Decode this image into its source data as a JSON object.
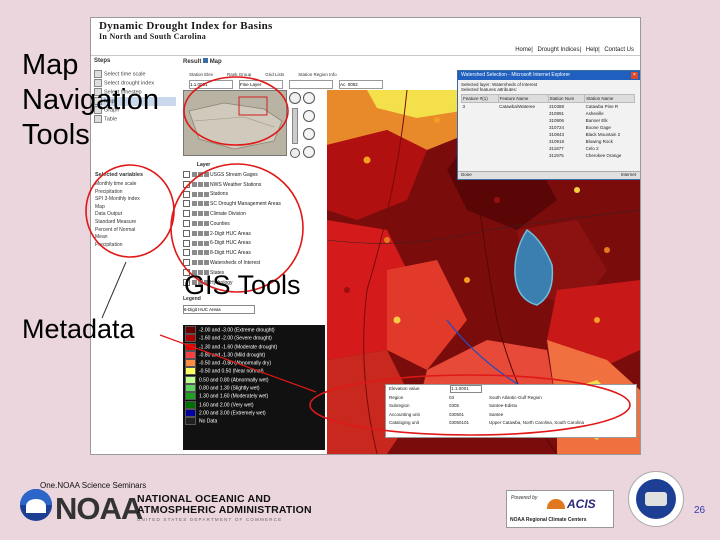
{
  "app": {
    "title": "Dynamic Drought Index for Basins",
    "subtitle": "In North and South Carolina",
    "nav": [
      "Home",
      "Drought Indices",
      "Help",
      "Contact Us"
    ]
  },
  "left_panel": {
    "steps_header": "Steps",
    "steps": [
      "Select time scale",
      "Select drought index",
      "Select timestep",
      "Map",
      "Graph",
      "Table"
    ],
    "selected_header": "Selected variables",
    "selected_items": [
      "Monthly time scale",
      "Precipitation",
      "SPI 3-Monthly index",
      "Map",
      "Data Output",
      "Standard Measure",
      "Percent of Normal",
      "Mean",
      "Precipitation"
    ]
  },
  "result_header": "Result",
  "map_tab": "Map",
  "toolbar_fields": [
    "Station Elev",
    "Rank Group",
    "Grid Lists",
    "Station Region Info"
  ],
  "toolbar_values": [
    "1.1.0001",
    "Fine Layer",
    "",
    "Ac. 0002"
  ],
  "layers_header": "Layer",
  "layers": [
    "USGS Stream Gages",
    "NWS Weather Stations",
    "Stations",
    "SC Drought Management Areas",
    "Climate Division",
    "Counties",
    "2-Digit HUC Areas",
    "6-Digit HUC Areas",
    "8-Digit HUC Areas",
    "Watersheds of Interest",
    "States",
    "Hydrology"
  ],
  "legend_header": "Legend",
  "legend_dropdown": "6-Digit HUC Areas",
  "legend": [
    {
      "label": "-2.00 and -3.00 (Extreme drought)",
      "color": "#6a0000"
    },
    {
      "label": "-1.60 and -2.00 (Severe drought)",
      "color": "#b00000"
    },
    {
      "label": "-1.30 and -1.60 (Moderate drought)",
      "color": "#e60000"
    },
    {
      "label": "-0.80 and -1.30 (Mild drought)",
      "color": "#ff4040"
    },
    {
      "label": "-0.50 and -0.80 (Abnormally dry)",
      "color": "#ff8c40"
    },
    {
      "label": "-0.50 and 0.50 (Near normal)",
      "color": "#ffff60"
    },
    {
      "label": "0.50 and 0.80 (Abnormally wet)",
      "color": "#c0ff90"
    },
    {
      "label": "0.80 and 1.30 (Slightly wet)",
      "color": "#60d060"
    },
    {
      "label": "1.30 and 1.60 (Moderately wet)",
      "color": "#20a020"
    },
    {
      "label": "1.60 and 2.00 (Very wet)",
      "color": "#007000"
    },
    {
      "label": "2.00 and 3.00 (Extremely wet)",
      "color": "#0000a0"
    },
    {
      "label": "No Data",
      "color": "#202020"
    }
  ],
  "popup": {
    "title": "Watershed Selection - Microsoft Internet Explorer",
    "line1": "Selected layer: Watersheds of Interest",
    "line2": "Selected features attributes:",
    "headers": [
      "Feature #(1)",
      "Feature Name",
      "Station Num",
      "Station Name"
    ],
    "rows": [
      [
        "3",
        "Catawba/Wateree",
        "310388",
        "Catawba Pine R"
      ],
      [
        "",
        "",
        "310891",
        "Asheville"
      ],
      [
        "",
        "",
        "310906",
        "Banner Elk"
      ],
      [
        "",
        "",
        "310724",
        "Boone Gage"
      ],
      [
        "",
        "",
        "310843",
        "Black Mountain 2"
      ],
      [
        "",
        "",
        "310918",
        "Blowing Rock"
      ],
      [
        "",
        "",
        "311877",
        "Celo 2"
      ],
      [
        "",
        "",
        "311975",
        "Cherokee Orange"
      ]
    ],
    "status": "Done",
    "zone": "Internet"
  },
  "metadata": {
    "headers": [
      "Elevation value",
      "1.1.0001"
    ],
    "rows": [
      [
        "Region",
        "03",
        "South Atlantic-Gulf Region"
      ],
      [
        "Subregion",
        "0305",
        "Santee-Edisto"
      ],
      [
        "Accounting unit",
        "030501",
        "Santee"
      ],
      [
        "Cataloging unit",
        "03050101",
        "Upper Catawba, North Carolina, South Carolina"
      ]
    ]
  },
  "annotations": {
    "map_nav": [
      "Map",
      "Navigation",
      "Tools"
    ],
    "gis": "GIS Tools",
    "metadata": "Metadata"
  },
  "footer": {
    "seminar": "One.NOAA Science Seminars",
    "noaa": "NOAA",
    "noaa_line1": "NATIONAL OCEANIC AND",
    "noaa_line2": "ATMOSPHERIC ADMINISTRATION",
    "noaa_sub": "UNITED STATES DEPARTMENT OF COMMERCE",
    "powered_by": "Powered by",
    "acis": "ACIS",
    "acis_caption": "NOAA Regional Climate Centers",
    "page_number": "26"
  },
  "colors": {
    "annotation_red": "#e01818",
    "map_dark_red": "#7a0c0c",
    "popup_title_blue": "#1f5fbf"
  }
}
